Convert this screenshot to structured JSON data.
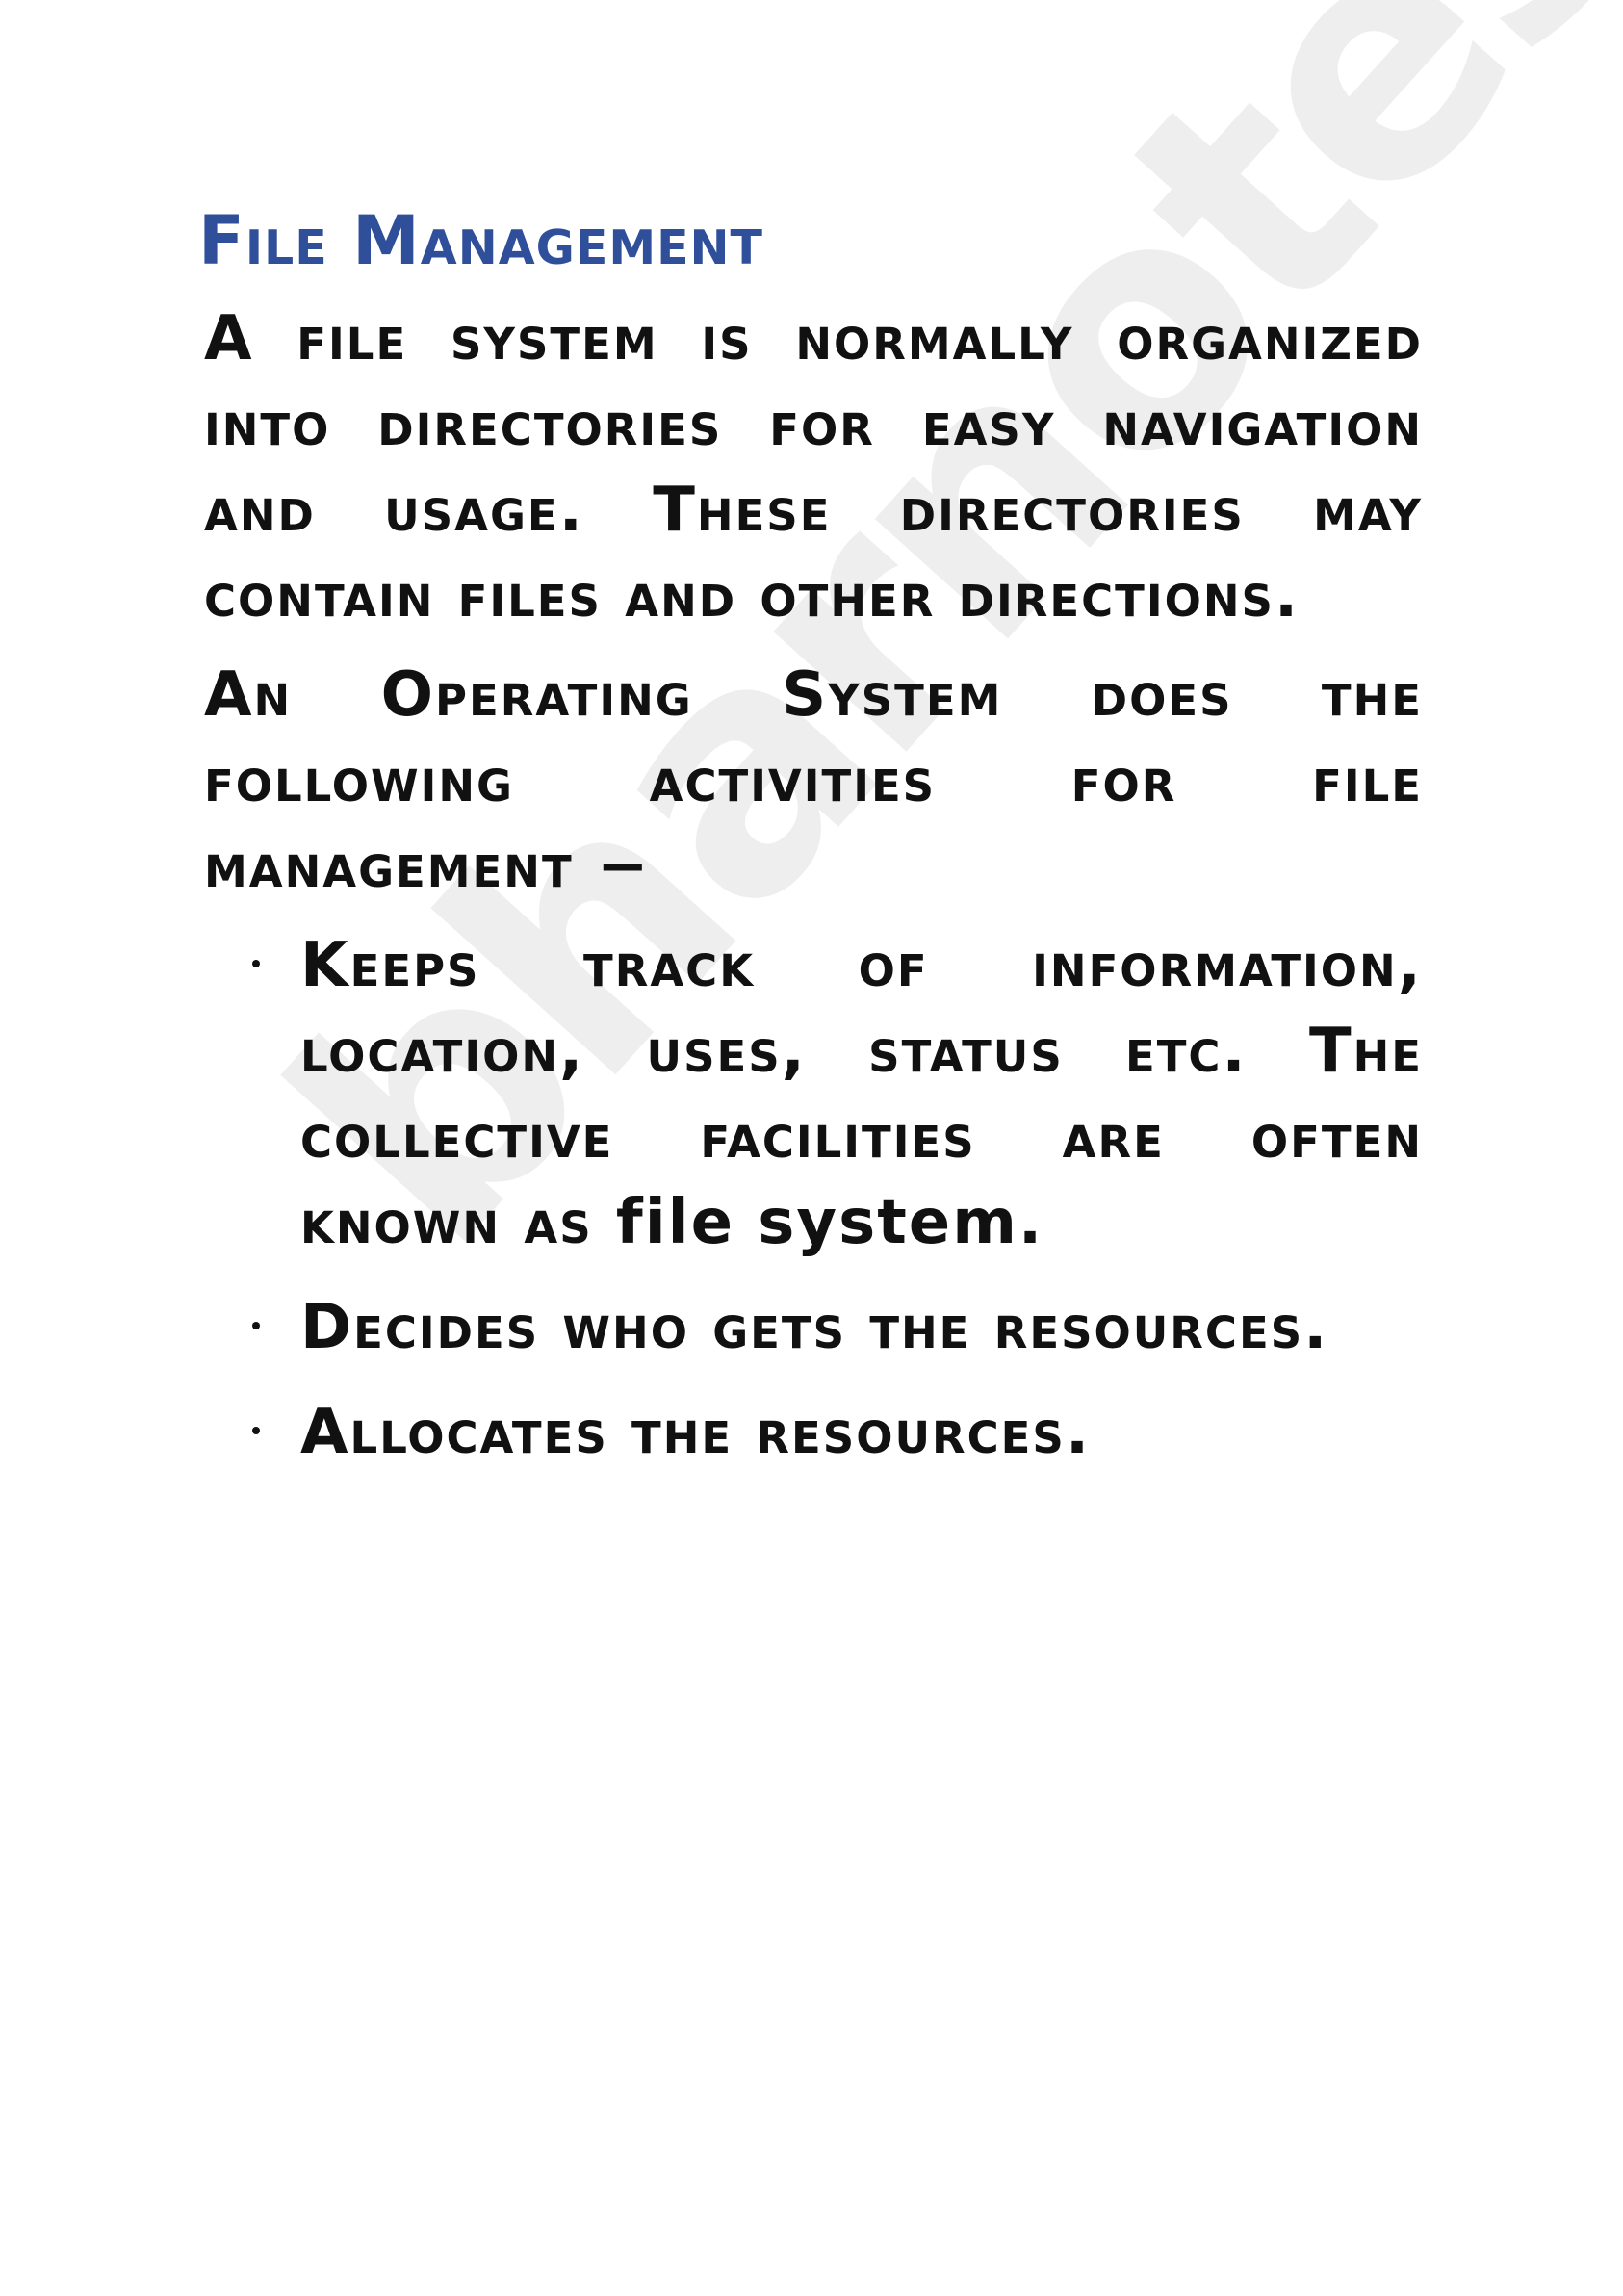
{
  "heading": "File Management",
  "paragraphs": [
    "A file system is normally organized into directories for easy navigation and usage. These directories may contain files and other directions.",
    "An Operating System does the following activities for file management −"
  ],
  "bullets": [
    {
      "text": "Keeps track of information, location, uses, status etc. The collective facilities are often known as",
      "term": "file system."
    },
    {
      "text": "Decides who gets the resources.",
      "term": ""
    },
    {
      "text": "Allocates the resources.",
      "term": ""
    }
  ],
  "watermark": "bharnotes"
}
